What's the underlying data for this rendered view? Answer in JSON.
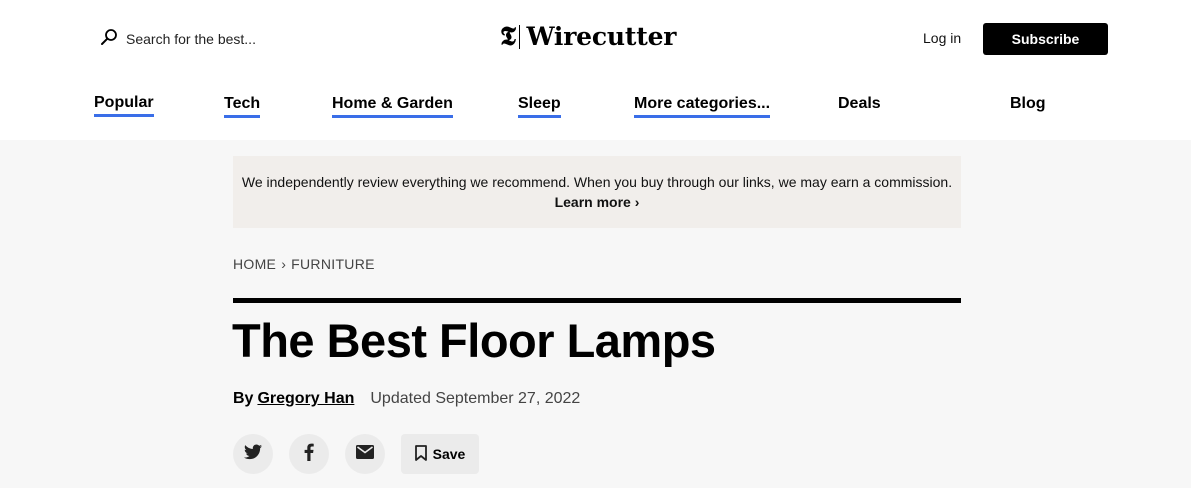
{
  "header": {
    "search_placeholder": "Search for the best...",
    "logo_mark": "𝕿",
    "logo_text": "Wirecutter",
    "login_label": "Log in",
    "subscribe_label": "Subscribe"
  },
  "nav": {
    "items": [
      {
        "label": "Popular"
      },
      {
        "label": "Tech"
      },
      {
        "label": "Home & Garden"
      },
      {
        "label": "Sleep"
      },
      {
        "label": "More categories..."
      },
      {
        "label": "Deals"
      },
      {
        "label": "Blog"
      }
    ],
    "accent_color": "#3a6ee8"
  },
  "disclosure": {
    "text": "We independently review everything we recommend. When you buy through our links, we may earn a commission.",
    "link_label": "Learn more ›"
  },
  "breadcrumb": {
    "home": "HOME",
    "separator": "›",
    "section": "FURNITURE"
  },
  "article": {
    "title": "The Best Floor Lamps",
    "by_label": "By",
    "author": "Gregory Han",
    "updated": "Updated September 27, 2022"
  },
  "share": {
    "icons": [
      "twitter-icon",
      "facebook-icon",
      "email-icon",
      "bookmark-icon"
    ],
    "save_label": "Save"
  }
}
